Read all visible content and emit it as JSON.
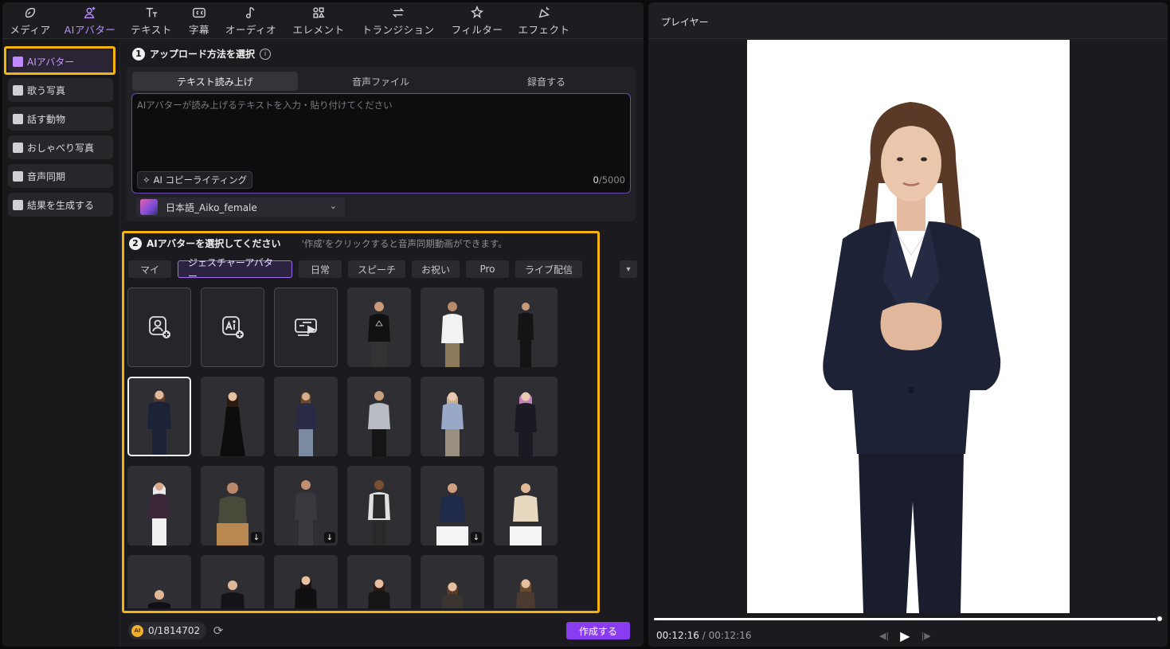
{
  "toolbar": {
    "items": [
      {
        "label": "メディア",
        "icon": "media-icon"
      },
      {
        "label": "AIアバター",
        "icon": "ai-avatar-icon"
      },
      {
        "label": "テキスト",
        "icon": "text-icon"
      },
      {
        "label": "字幕",
        "icon": "subtitle-icon"
      },
      {
        "label": "オーディオ",
        "icon": "audio-icon"
      },
      {
        "label": "エレメント",
        "icon": "element-icon"
      },
      {
        "label": "トランジション",
        "icon": "transition-icon"
      },
      {
        "label": "フィルター",
        "icon": "filter-icon"
      },
      {
        "label": "エフェクト",
        "icon": "effect-icon"
      }
    ]
  },
  "sidebar": {
    "items": [
      {
        "label": "AIアバター"
      },
      {
        "label": "歌う写真"
      },
      {
        "label": "話す動物"
      },
      {
        "label": "おしゃべり写真"
      },
      {
        "label": "音声同期"
      },
      {
        "label": "結果を生成する"
      }
    ]
  },
  "section1": {
    "number": "1",
    "title": "アップロード方法を選択",
    "tabs": [
      "テキスト読み上げ",
      "音声ファイル",
      "録音する"
    ],
    "placeholder": "AIアバターが読み上げるテキストを入力・貼り付けてください",
    "copywriting_label": "AI コピーライティング",
    "char_count": "0",
    "char_limit": "/5000",
    "voice": "日本語_Aiko_female"
  },
  "section2": {
    "number": "2",
    "title": "AIアバターを選択してください",
    "note": "'作成'をクリックすると音声同期動画ができます。",
    "tabs": [
      "マイ",
      "ジェスチャーアバター",
      "日常",
      "スピーチ",
      "お祝い",
      "Pro",
      "ライブ配信"
    ]
  },
  "footer": {
    "credits": "0/1814702",
    "credit_badge": "AI",
    "create_label": "作成する"
  },
  "player": {
    "title": "プレイヤー",
    "current_time": "00:12:16",
    "separator": " / ",
    "total_time": "00:12:16",
    "progress": 1.0
  },
  "colors": {
    "accent": "#8a3cf0",
    "highlight": "#f5b40b"
  }
}
